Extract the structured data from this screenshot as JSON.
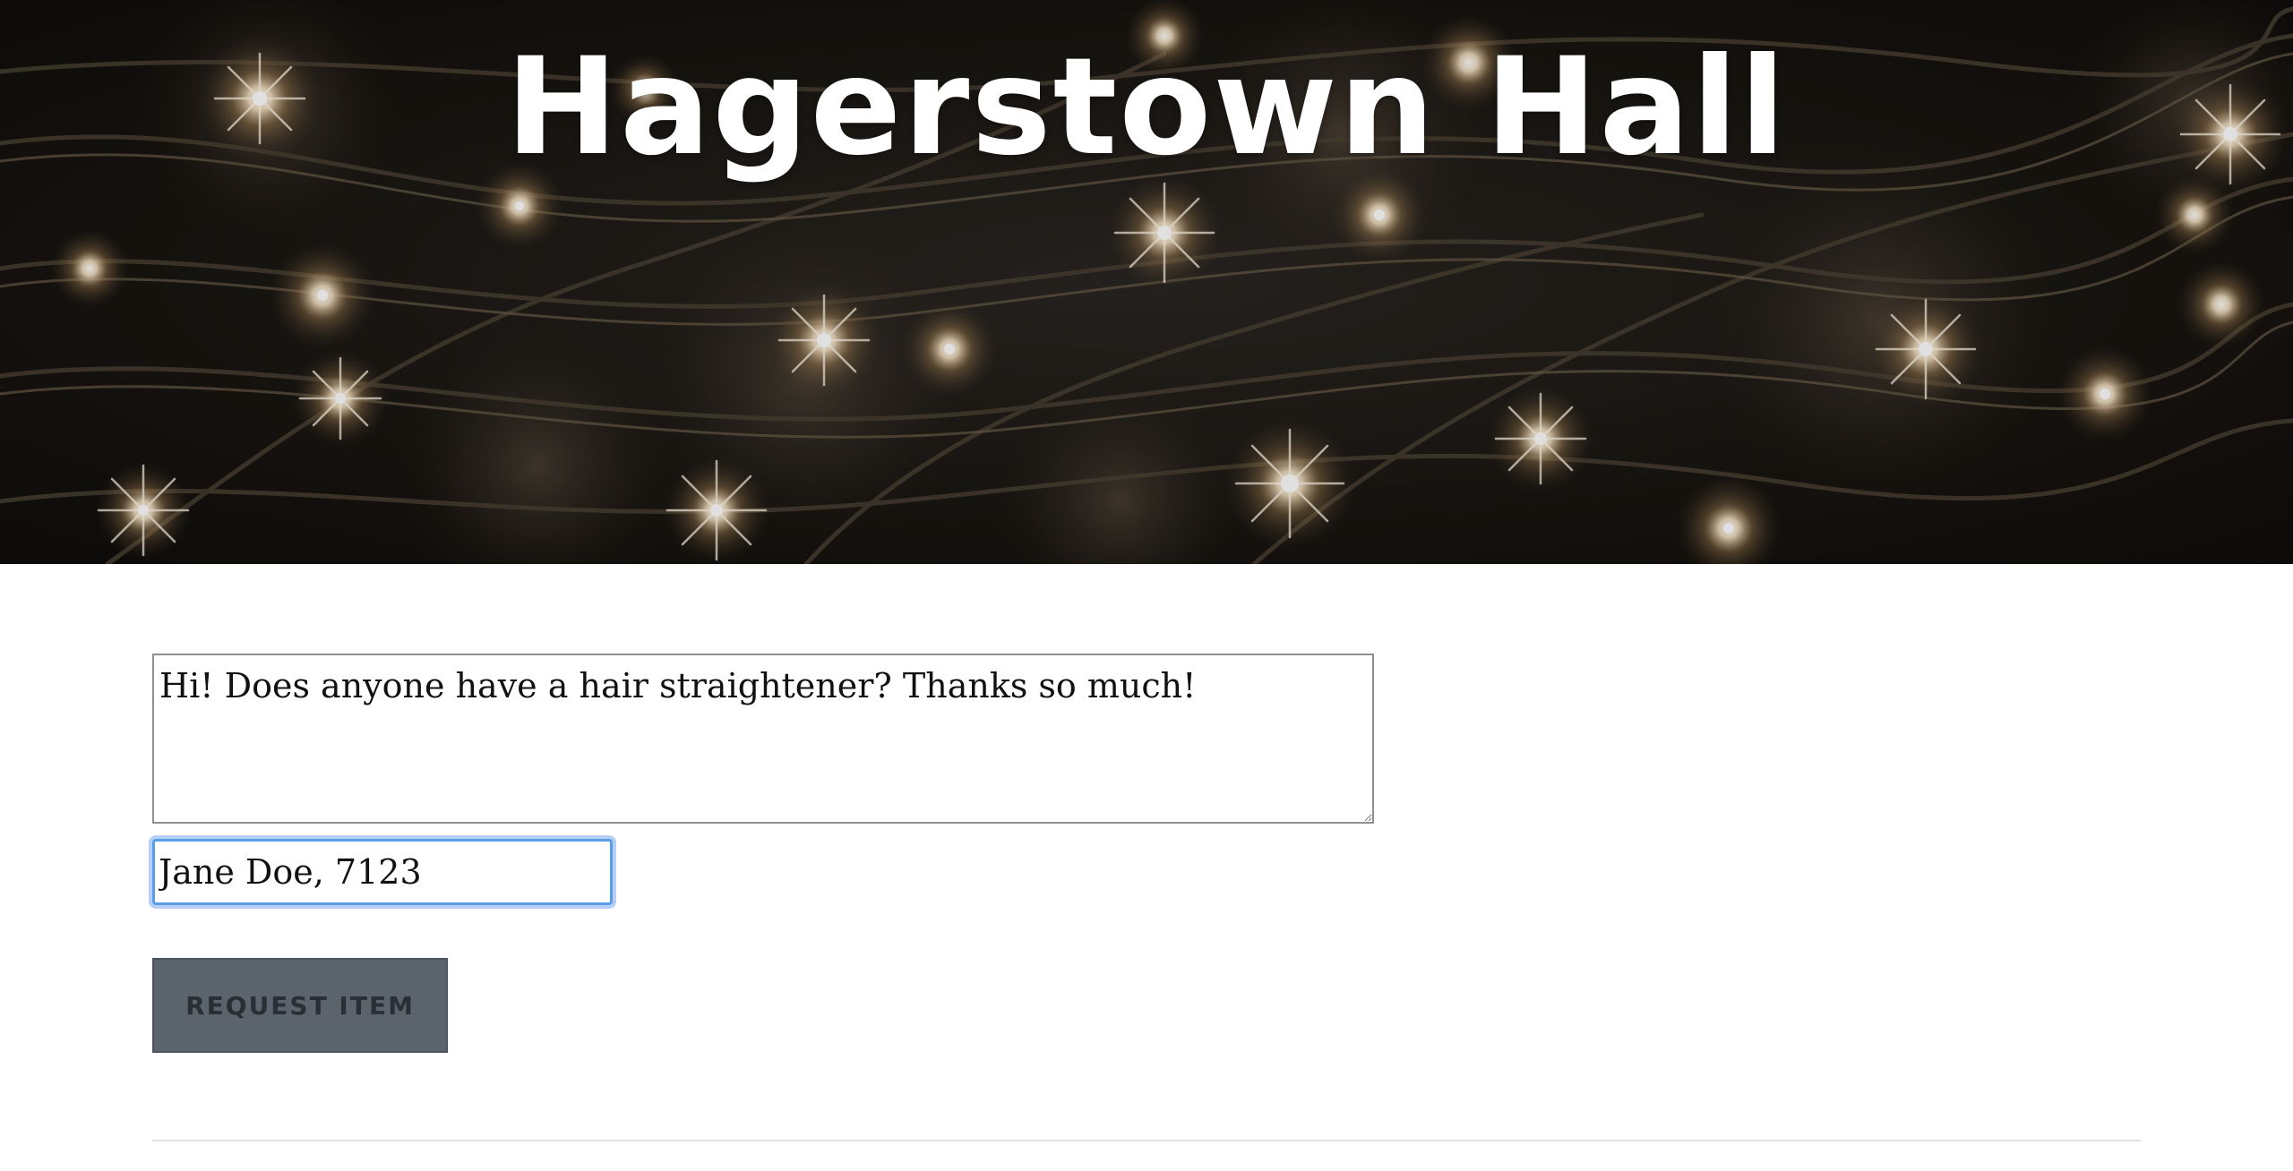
{
  "header": {
    "title": "Hagerstown Hall"
  },
  "form": {
    "request_message": "Hi! Does anyone have a hair straightener? Thanks so much!",
    "requester": "Jane Doe, 7123",
    "submit_label": "Request Item"
  },
  "colors": {
    "button_background": "#5b636c",
    "input_focus_ring": "#5b9de6",
    "title_text": "#ffffff"
  }
}
